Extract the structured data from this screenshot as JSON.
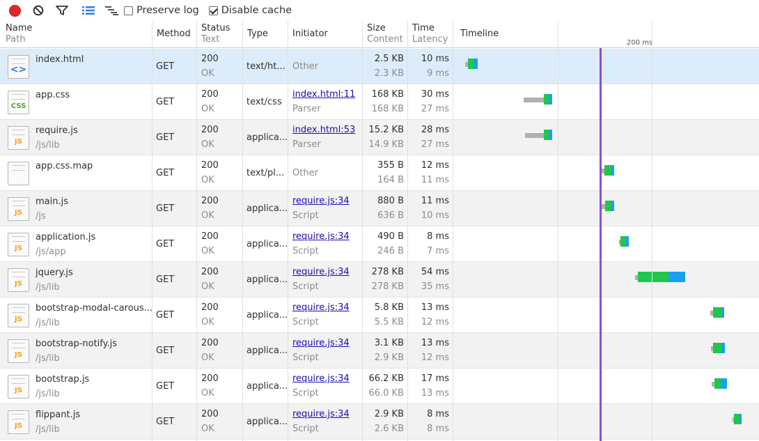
{
  "toolbar": {
    "preserve_log_label": "Preserve log",
    "preserve_log_checked": false,
    "disable_cache_label": "Disable cache",
    "disable_cache_checked": true
  },
  "columns": {
    "name": "Name",
    "path": "Path",
    "method": "Method",
    "status": "Status",
    "text": "Text",
    "type": "Type",
    "initiator": "Initiator",
    "size": "Size",
    "content": "Content",
    "time": "Time",
    "latency": "Latency",
    "timeline": "Timeline",
    "timeline_marker": "200 ms"
  },
  "requests": [
    {
      "name": "index.html",
      "path": "",
      "method": "GET",
      "status": "200",
      "status_text": "OK",
      "type": "text/ht...",
      "initiator": "Other",
      "initiator_link": false,
      "initiator_sub": "",
      "size": "2.5 KB",
      "content": "2.3 KB",
      "time": "10 ms",
      "latency": "9 ms",
      "icon": "html-file-icon"
    },
    {
      "name": "app.css",
      "path": "",
      "method": "GET",
      "status": "200",
      "status_text": "OK",
      "type": "text/css",
      "initiator": "index.html:11",
      "initiator_link": true,
      "initiator_sub": "Parser",
      "size": "168 KB",
      "content": "168 KB",
      "time": "30 ms",
      "latency": "27 ms",
      "icon": "css-file-icon"
    },
    {
      "name": "require.js",
      "path": "/js/lib",
      "method": "GET",
      "status": "200",
      "status_text": "OK",
      "type": "applica...",
      "initiator": "index.html:53",
      "initiator_link": true,
      "initiator_sub": "Parser",
      "size": "15.2 KB",
      "content": "14.9 KB",
      "time": "28 ms",
      "latency": "27 ms",
      "icon": "js-file-icon"
    },
    {
      "name": "app.css.map",
      "path": "",
      "method": "GET",
      "status": "200",
      "status_text": "OK",
      "type": "text/pl...",
      "initiator": "Other",
      "initiator_link": false,
      "initiator_sub": "",
      "size": "355 B",
      "content": "164 B",
      "time": "12 ms",
      "latency": "11 ms",
      "icon": "blank-file-icon"
    },
    {
      "name": "main.js",
      "path": "/js",
      "method": "GET",
      "status": "200",
      "status_text": "OK",
      "type": "applica...",
      "initiator": "require.js:34",
      "initiator_link": true,
      "initiator_sub": "Script",
      "size": "880 B",
      "content": "636 B",
      "time": "11 ms",
      "latency": "10 ms",
      "icon": "js-file-icon"
    },
    {
      "name": "application.js",
      "path": "/js/app",
      "method": "GET",
      "status": "200",
      "status_text": "OK",
      "type": "applica...",
      "initiator": "require.js:34",
      "initiator_link": true,
      "initiator_sub": "Script",
      "size": "490 B",
      "content": "246 B",
      "time": "8 ms",
      "latency": "7 ms",
      "icon": "js-file-icon"
    },
    {
      "name": "jquery.js",
      "path": "/js/lib",
      "method": "GET",
      "status": "200",
      "status_text": "OK",
      "type": "applica...",
      "initiator": "require.js:34",
      "initiator_link": true,
      "initiator_sub": "Script",
      "size": "278 KB",
      "content": "278 KB",
      "time": "54 ms",
      "latency": "35 ms",
      "icon": "js-file-icon"
    },
    {
      "name": "bootstrap-modal-carous...",
      "path": "/js/lib",
      "method": "GET",
      "status": "200",
      "status_text": "OK",
      "type": "applica...",
      "initiator": "require.js:34",
      "initiator_link": true,
      "initiator_sub": "Script",
      "size": "5.8 KB",
      "content": "5.5 KB",
      "time": "13 ms",
      "latency": "12 ms",
      "icon": "js-file-icon"
    },
    {
      "name": "bootstrap-notify.js",
      "path": "/js/lib",
      "method": "GET",
      "status": "200",
      "status_text": "OK",
      "type": "applica...",
      "initiator": "require.js:34",
      "initiator_link": true,
      "initiator_sub": "Script",
      "size": "3.1 KB",
      "content": "2.9 KB",
      "time": "13 ms",
      "latency": "12 ms",
      "icon": "js-file-icon"
    },
    {
      "name": "bootstrap.js",
      "path": "/js/lib",
      "method": "GET",
      "status": "200",
      "status_text": "OK",
      "type": "applica...",
      "initiator": "require.js:34",
      "initiator_link": true,
      "initiator_sub": "Script",
      "size": "66.2 KB",
      "content": "66.0 KB",
      "time": "17 ms",
      "latency": "13 ms",
      "icon": "js-file-icon"
    },
    {
      "name": "flippant.js",
      "path": "/js/lib",
      "method": "GET",
      "status": "200",
      "status_text": "OK",
      "type": "applica...",
      "initiator": "require.js:34",
      "initiator_link": true,
      "initiator_sub": "Script",
      "size": "2.9 KB",
      "content": "2.6 KB",
      "time": "8 ms",
      "latency": "8 ms",
      "icon": "js-file-icon"
    }
  ],
  "icon_badges": {
    "html-file-icon": "<>",
    "css-file-icon": "CSS",
    "js-file-icon": "JS",
    "blank-file-icon": ""
  },
  "colors": {
    "waiting": "#1fc74b",
    "receiving": "#19a0f0",
    "queued": "#b0b0b0",
    "load_marker": "#8a4fd0",
    "selected_row": "#dcecfb"
  }
}
